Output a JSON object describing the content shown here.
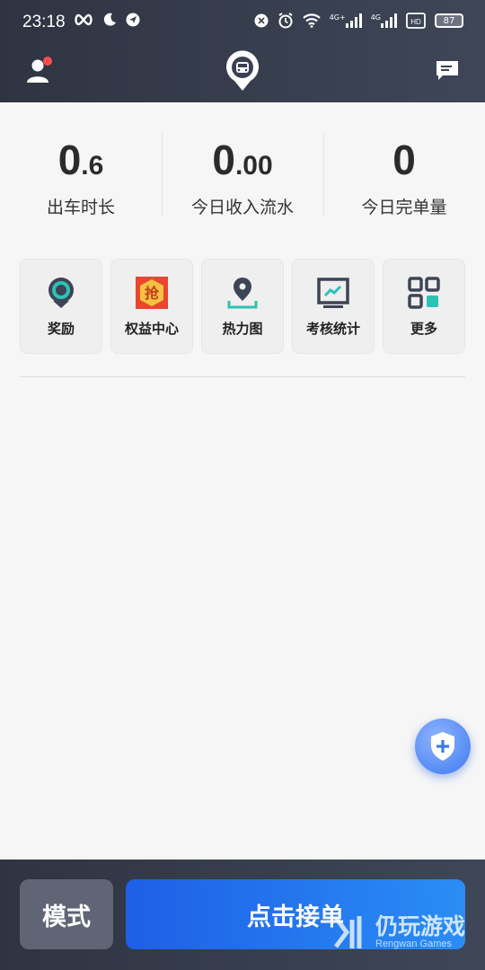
{
  "status_bar": {
    "time": "23:18",
    "battery": "87",
    "sim1_label": "4G+",
    "sim2_label": "4G",
    "hd_label": "HD"
  },
  "header": {
    "user_icon": "user-icon",
    "logo_icon": "car-pin-logo-icon",
    "message_icon": "message-icon",
    "has_notification": true
  },
  "stats": [
    {
      "int": "0",
      "dec": ".6",
      "label": "出车时长"
    },
    {
      "int": "0",
      "dec": ".00",
      "label": "今日收入流水"
    },
    {
      "int": "0",
      "dec": "",
      "label": "今日完单量"
    }
  ],
  "tools": [
    {
      "label": "奖励",
      "icon": "reward-badge-icon"
    },
    {
      "label": "权益中心",
      "icon": "grab-icon",
      "icon_text": "抢"
    },
    {
      "label": "热力图",
      "icon": "location-pin-icon"
    },
    {
      "label": "考核统计",
      "icon": "chart-icon"
    },
    {
      "label": "更多",
      "icon": "grid-icon"
    }
  ],
  "fab": {
    "icon": "shield-plus-icon"
  },
  "bottom": {
    "mode_label": "模式",
    "accept_label": "点击接单"
  },
  "watermark": {
    "title": "仍玩游戏",
    "subtitle": "Rengwan Games"
  },
  "colors": {
    "header_bg": "#2f3442",
    "accent_blue": "#1e5fe6",
    "teal": "#2bc3b4",
    "notification": "#ff4d4f"
  }
}
